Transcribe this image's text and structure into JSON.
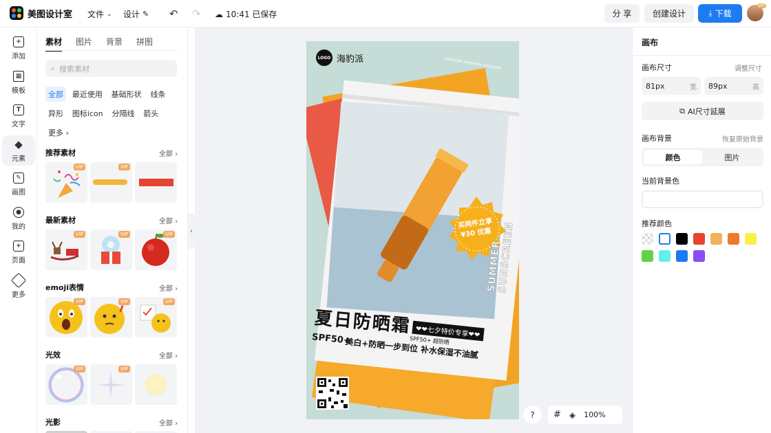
{
  "app": {
    "name": "美图设计室"
  },
  "topbar": {
    "file_menu": "文件",
    "design_menu": "设计",
    "save_status": "10:41 已保存",
    "share_label": "分 享",
    "create_label": "创建设计",
    "download_label": "下载",
    "avatar_badge": "VIP"
  },
  "rail": [
    {
      "label": "添加",
      "icon": "plus-box-icon"
    },
    {
      "label": "模板",
      "icon": "template-icon"
    },
    {
      "label": "文字",
      "icon": "text-icon"
    },
    {
      "label": "元素",
      "icon": "shapes-icon"
    },
    {
      "label": "画图",
      "icon": "draw-icon"
    },
    {
      "label": "我的",
      "icon": "user-icon"
    },
    {
      "label": "页面",
      "icon": "page-add-icon"
    },
    {
      "label": "更多",
      "icon": "cube-icon"
    }
  ],
  "assets": {
    "tabs": [
      "素材",
      "图片",
      "背景",
      "拼图"
    ],
    "search_placeholder": "搜索素材",
    "chips": [
      "全部",
      "最近使用",
      "基础形状",
      "线条",
      "异形",
      "图标icon",
      "分隔线",
      "箭头",
      "更多"
    ],
    "all_label": "全部",
    "vip_label": "VIP",
    "sections": [
      {
        "title": "推荐素材"
      },
      {
        "title": "最新素材"
      },
      {
        "title": "emoji表情"
      },
      {
        "title": "光效"
      },
      {
        "title": "光影"
      }
    ]
  },
  "poster": {
    "brand": "海豹派",
    "logo_text": "LOGO",
    "headline": "夏日防晒霜",
    "tag": "❤❤七夕特价专享❤❤",
    "spf_small": "SPF50+ 超防晒",
    "spf": "SPF50+",
    "slogan": "美白+防晒一步到位 补水保湿不油腻",
    "badge_line1": "买两件立享",
    "badge_line2": "¥30 优惠",
    "side_text": "SUMMER SUNSCREEN",
    "strip_text": "HAIBAOPAI HAIBAOPAI HAIBAOPAI"
  },
  "stage": {
    "zoom": "100%",
    "help": "?"
  },
  "props": {
    "title": "画布",
    "size_label": "画布尺寸",
    "size_adjust": "调整尺寸",
    "width_value": "81px",
    "width_unit": "宽",
    "height_value": "89px",
    "height_unit": "高",
    "ai_extend": "AI尺寸延展",
    "bg_label": "画布背景",
    "bg_restore": "恢复原始背景",
    "seg_color": "颜色",
    "seg_image": "图片",
    "current_bg": "当前背景色",
    "recommended": "推荐颜色",
    "swatches": [
      "transparent",
      "#ffffff",
      "#000000",
      "#e8432e",
      "#f2b25a",
      "#ee7a2c",
      "#fbf046",
      "#5fd343",
      "#62f0ee",
      "#1f78f0",
      "#8b4cf2"
    ]
  }
}
